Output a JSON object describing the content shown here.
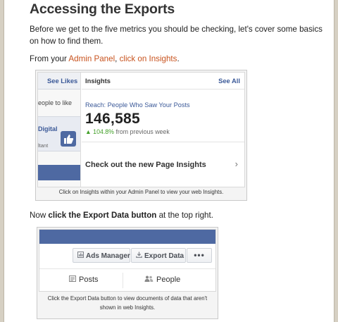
{
  "article": {
    "heading": "Accessing the Exports",
    "intro": "Before we get to the five metrics you should be checking, let's cover some basics on how to find them.",
    "step1": {
      "prefix": "From your ",
      "link1": "Admin Panel",
      "sep": ", ",
      "link2": "click on Insights",
      "suffix": "."
    },
    "step2": {
      "prefix": "Now ",
      "bold": "click the Export Data button",
      "suffix": " at the top right."
    }
  },
  "figure1": {
    "left": {
      "see_likes": "See Likes",
      "people_like": "eople to like",
      "digital": "Digital",
      "ltant": "ltant"
    },
    "insights": {
      "title": "Insights",
      "see_all": "See All",
      "reach_label": "Reach: People Who Saw Your Posts",
      "reach_value": "146,585",
      "change_arrow": "▲",
      "change_value": "104.8%",
      "change_text": " from previous week",
      "checkout": "Check out the new Page Insights",
      "chevron": "›"
    },
    "caption": "Click on Insights within your Admin Panel to view your web Insights."
  },
  "figure2": {
    "buttons": {
      "ads_manager": "Ads Manager",
      "export_data": "Export Data",
      "more": "•••"
    },
    "tabs": {
      "posts": "Posts",
      "people": "People"
    },
    "caption": "Click the Export Data button to view documents of data that aren't shown in web Insights."
  },
  "icons": {
    "ads_manager": "ads-manager-icon",
    "export": "download-icon",
    "posts": "posts-icon",
    "people": "people-icon",
    "thumb": "thumbs-up-icon"
  },
  "colors": {
    "link": "#c8531e",
    "facebook_blue": "#4e69a2",
    "positive": "#42a028"
  }
}
